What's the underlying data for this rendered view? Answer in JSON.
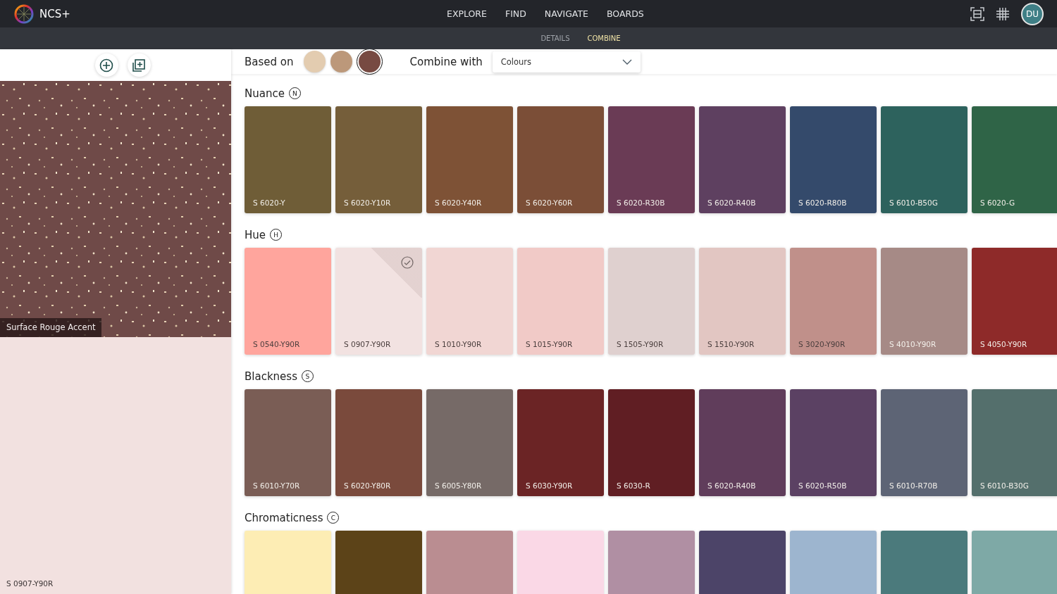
{
  "app": {
    "logo_text": "NCS+",
    "nav": [
      "EXPLORE",
      "FIND",
      "NAVIGATE",
      "BOARDS"
    ],
    "user_initials": "DU"
  },
  "subtabs": [
    {
      "label": "DETAILS",
      "selected": false
    },
    {
      "label": "COMBINE",
      "selected": true
    }
  ],
  "sidebar": {
    "material_label": "Surface Rouge Accent",
    "colour_code": "S 0907-Y90R"
  },
  "based_on": {
    "label": "Based on",
    "swatches": [
      {
        "color": "#e3ccb0",
        "selected": false
      },
      {
        "color": "#bc987a",
        "selected": false
      },
      {
        "color": "#774a42",
        "selected": true
      }
    ]
  },
  "combine_with": {
    "label": "Combine with",
    "value": "Colours"
  },
  "sections": [
    {
      "title": "Nuance",
      "badge": "N",
      "cards": [
        {
          "code": "S 6020-Y",
          "color": "#6f5d37",
          "checked": false
        },
        {
          "code": "S 6020-Y10R",
          "color": "#755e3a",
          "checked": false
        },
        {
          "code": "S 6020-Y40R",
          "color": "#7e5236",
          "checked": false
        },
        {
          "code": "S 6020-Y60R",
          "color": "#7b4e37",
          "checked": false
        },
        {
          "code": "S 6020-R30B",
          "color": "#6a3b55",
          "checked": false
        },
        {
          "code": "S 6020-R40B",
          "color": "#5e4060",
          "checked": false
        },
        {
          "code": "S 6020-R80B",
          "color": "#344a6b",
          "checked": false
        },
        {
          "code": "S 6010-B50G",
          "color": "#2d625d",
          "checked": false
        },
        {
          "code": "S 6020-G",
          "color": "#2f6447",
          "checked": false
        }
      ]
    },
    {
      "title": "Hue",
      "badge": "H",
      "cards": [
        {
          "code": "S 0540-Y90R",
          "color": "#ffa59d",
          "checked": false
        },
        {
          "code": "S 0907-Y90R",
          "color": "#f2e2e1",
          "checked": true
        },
        {
          "code": "S 1010-Y90R",
          "color": "#f1d6d3",
          "checked": false
        },
        {
          "code": "S 1015-Y90R",
          "color": "#f1cac7",
          "checked": false
        },
        {
          "code": "S 1505-Y90R",
          "color": "#dfd0cf",
          "checked": false
        },
        {
          "code": "S 1510-Y90R",
          "color": "#e2c6c2",
          "checked": false
        },
        {
          "code": "S 3020-Y90R",
          "color": "#c0908a",
          "checked": false
        },
        {
          "code": "S 4010-Y90R",
          "color": "#a68a86",
          "checked": false
        },
        {
          "code": "S 4050-Y90R",
          "color": "#8e2a29",
          "checked": false
        }
      ]
    },
    {
      "title": "Blackness",
      "badge": "S",
      "cards": [
        {
          "code": "S 6010-Y70R",
          "color": "#7a5d55",
          "checked": false
        },
        {
          "code": "S 6020-Y80R",
          "color": "#7a4a3c",
          "checked": false
        },
        {
          "code": "S 6005-Y80R",
          "color": "#766a67",
          "checked": false
        },
        {
          "code": "S 6030-Y90R",
          "color": "#6b2425",
          "checked": false
        },
        {
          "code": "S 6030-R",
          "color": "#601e23",
          "checked": false
        },
        {
          "code": "S 6020-R40B",
          "color": "#603d5b",
          "checked": false
        },
        {
          "code": "S 6020-R50B",
          "color": "#5b4163",
          "checked": false
        },
        {
          "code": "S 6010-R70B",
          "color": "#5d6475",
          "checked": false
        },
        {
          "code": "S 6010-B30G",
          "color": "#546f6c",
          "checked": false
        }
      ]
    },
    {
      "title": "Chromaticness",
      "badge": "C",
      "cards": [
        {
          "color": "#fdedb4",
          "checked": false
        },
        {
          "color": "#5c4318",
          "checked": false
        },
        {
          "color": "#ba8d91",
          "checked": false
        },
        {
          "color": "#fad8e6",
          "checked": false
        },
        {
          "color": "#b08fa3",
          "checked": false
        },
        {
          "color": "#4c4468",
          "checked": false
        },
        {
          "color": "#9db5cf",
          "checked": false
        },
        {
          "color": "#4b7a7c",
          "checked": false
        },
        {
          "color": "#7ea9a6",
          "checked": false
        }
      ]
    }
  ]
}
